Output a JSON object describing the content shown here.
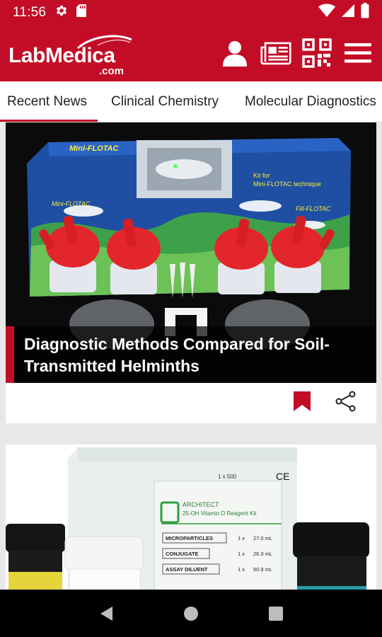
{
  "status_bar": {
    "time": "11:56",
    "icons": [
      "gear-icon",
      "sd-card-icon",
      "wifi-icon",
      "signal-icon",
      "battery-icon"
    ]
  },
  "app_bar": {
    "logo_text": "LabMedica",
    "logo_subtext": ".com",
    "actions": [
      "user-icon",
      "newspaper-icon",
      "qr-code-icon",
      "menu-icon"
    ]
  },
  "tabs": [
    {
      "label": "Recent News",
      "active": true
    },
    {
      "label": "Clinical Chemistry",
      "active": false
    },
    {
      "label": "Molecular Diagnostics",
      "active": false
    }
  ],
  "articles": [
    {
      "title": "Diagnostic Methods Compared for Soil-Transmitted Helminths",
      "image_text": {
        "brand": "Mini-FLOTAC",
        "kit_line1": "Kit for",
        "kit_line2": "Mini-FLOTAC technique",
        "side_brand": "Fill-FLOTAC"
      },
      "bookmarked": true
    },
    {
      "title": "",
      "image_text": {
        "brand": "ARCHITECT",
        "product": "25-OH Vitamin D Reagent Kit",
        "count": "1 x 500",
        "ce_mark": "CE",
        "rows": [
          {
            "name": "MICROPARTICLES",
            "qty": "1 x",
            "vol": "27.0 mL"
          },
          {
            "name": "CONJUGATE",
            "qty": "1 x",
            "vol": "26.3 mL"
          },
          {
            "name": "ASSAY DILUENT",
            "qty": "1 x",
            "vol": "50.9 mL"
          }
        ]
      }
    }
  ],
  "colors": {
    "brand_red": "#c30d26",
    "nav_black": "#000000"
  },
  "nav_bar": [
    "back-icon",
    "home-icon",
    "recents-icon"
  ]
}
